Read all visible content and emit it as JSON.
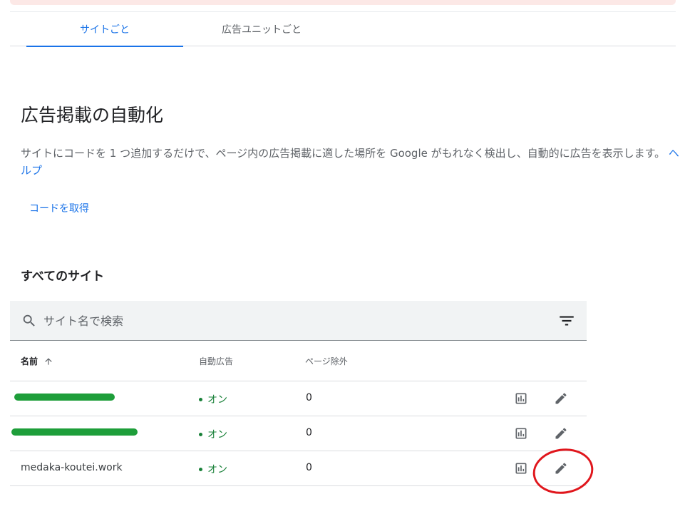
{
  "tabs": [
    {
      "label": "サイトごと",
      "active": true
    },
    {
      "label": "広告ユニットごと",
      "active": false
    }
  ],
  "section": {
    "title": "広告掲載の自動化",
    "description": "サイトにコードを 1 つ追加するだけで、ページ内の広告掲載に適した場所を Google がもれなく検出し、自動的に広告を表示します。",
    "help_link": "ヘルプ",
    "get_code_label": "コードを取得"
  },
  "all_sites": {
    "title": "すべてのサイト",
    "search_placeholder": "サイト名で検索"
  },
  "table": {
    "columns": {
      "name": "名前",
      "auto_ads": "自動広告",
      "page_exclusions": "ページ除外"
    },
    "rows": [
      {
        "name": "",
        "name_redacted": true,
        "status": "オン",
        "page_exclusions": "0"
      },
      {
        "name": "",
        "name_redacted": true,
        "status": "オン",
        "page_exclusions": "0"
      },
      {
        "name": "medaka-koutei.work",
        "name_redacted": false,
        "status": "オン",
        "page_exclusions": "0"
      }
    ]
  },
  "icons": {
    "search": "search-icon",
    "filter": "filter-icon",
    "sort": "arrow-upward-icon",
    "report": "bar-chart-icon",
    "edit": "pencil-icon"
  },
  "colors": {
    "accent": "#1a73e8",
    "status_on": "#188038",
    "redaction": "#1e9e3a",
    "annotation": "#e0161c",
    "alert_strip": "#fce8e6"
  }
}
